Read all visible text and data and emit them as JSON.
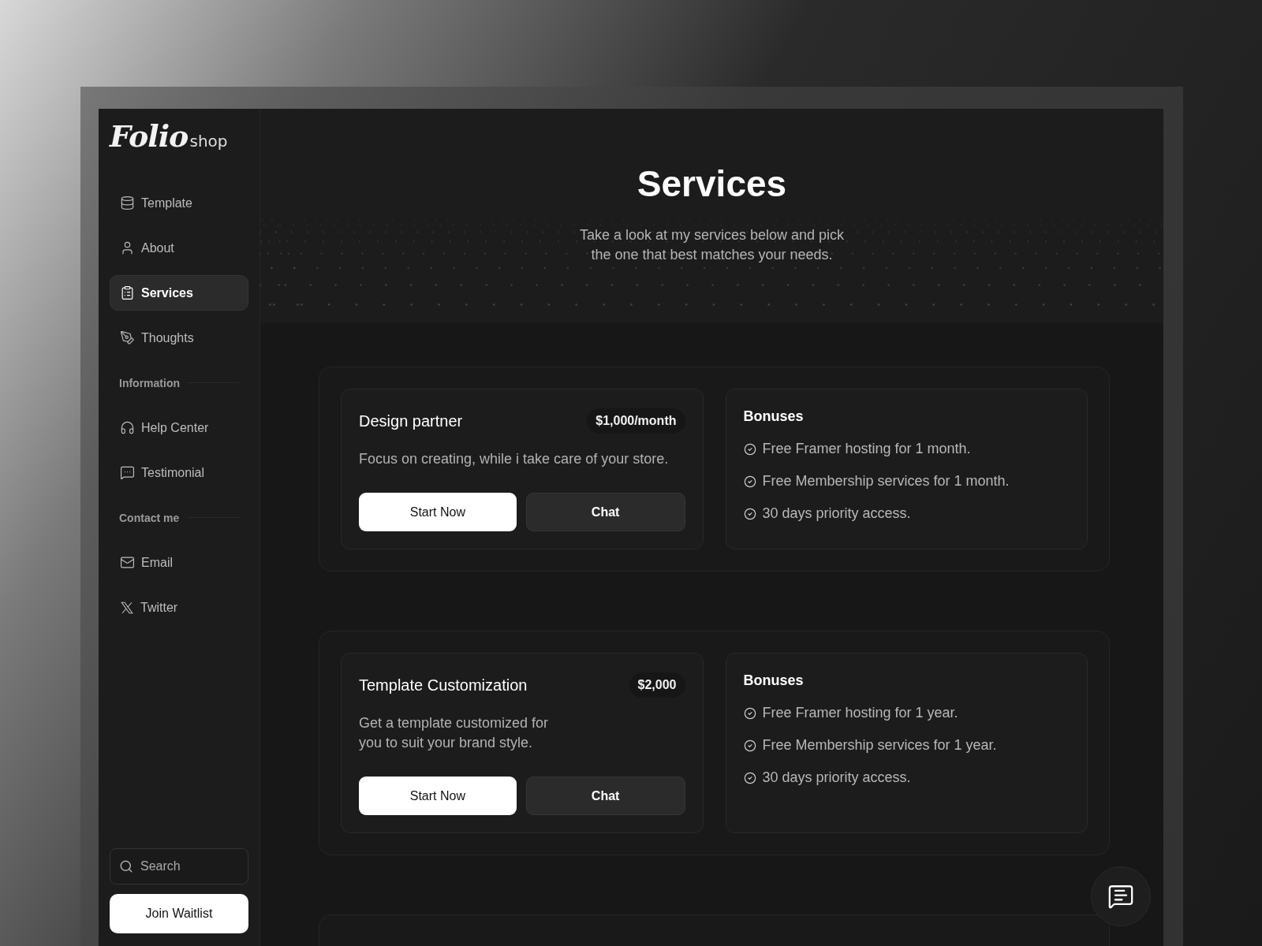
{
  "logo": {
    "script": "Folio",
    "suffix": "shop"
  },
  "sidebar": {
    "items": [
      {
        "kind": "link",
        "label": "Template",
        "selected": false
      },
      {
        "kind": "link",
        "label": "About",
        "selected": false
      },
      {
        "kind": "link",
        "label": "Services",
        "selected": true
      },
      {
        "kind": "link",
        "label": "Thoughts",
        "selected": false
      },
      {
        "kind": "heading",
        "label": "Information"
      },
      {
        "kind": "link",
        "label": "Help Center",
        "selected": false
      },
      {
        "kind": "link",
        "label": "Testimonial",
        "selected": false
      },
      {
        "kind": "heading",
        "label": "Contact me"
      },
      {
        "kind": "link",
        "label": "Email",
        "selected": false
      },
      {
        "kind": "link",
        "label": "Twitter",
        "selected": false
      }
    ],
    "search": {
      "placeholder": "Search"
    },
    "button": "Join Waitlist"
  },
  "hero": {
    "title": "Services",
    "subtitle_lines": [
      "Take a look at my services below and pick",
      "the one that best matches your needs."
    ]
  },
  "services": [
    {
      "title": "Design partner",
      "price": "$1,000/month",
      "description": [
        "Focus on creating, while i take care of your store."
      ],
      "buttons": [
        {
          "label": "Start Now",
          "kind": "primary"
        },
        {
          "label": "Chat",
          "kind": "secondary"
        }
      ],
      "bonuses_title": "Bonuses",
      "bonuses": [
        "Free Framer hosting for 1 month.",
        "Free Membership services for 1 month.",
        "30 days priority access."
      ]
    },
    {
      "title": "Template Customization",
      "price": "$2,000",
      "description": [
        "Get a template customized for",
        "you to suit your brand style."
      ],
      "buttons": [
        {
          "label": "Start Now",
          "kind": "primary"
        },
        {
          "label": "Chat",
          "kind": "secondary"
        }
      ],
      "bonuses_title": "Bonuses",
      "bonuses": [
        "Free Framer hosting for 1 year.",
        "Free Membership services for 1 year.",
        "30 days priority access."
      ]
    }
  ]
}
